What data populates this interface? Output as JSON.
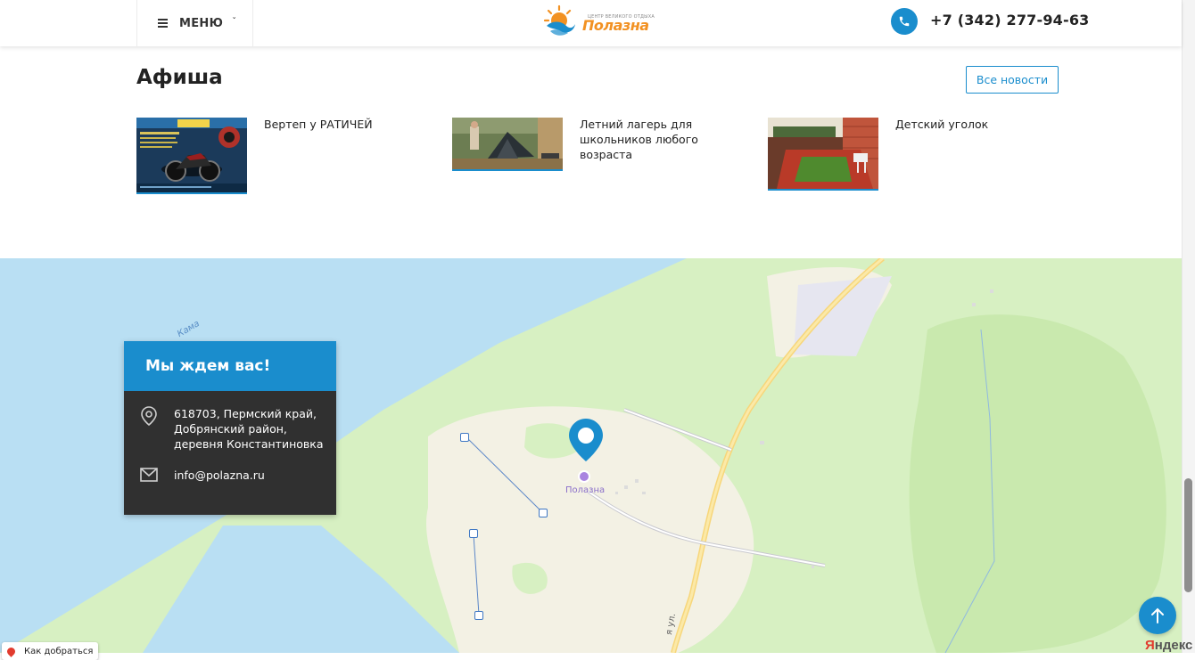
{
  "header": {
    "menu_label": "МЕНЮ",
    "menu_caret": "ˇ",
    "logo_small": "ЦЕНТР ВЕЛИКОГО ОТДЫХА",
    "logo_name": "Полазна",
    "phone": "+7 (342) 277-94-63"
  },
  "afisha": {
    "title": "Афиша",
    "all_news_label": "Все новости",
    "items": [
      {
        "title": "Вертеп у РАТИЧЕЙ",
        "image": "motorcycle-poster"
      },
      {
        "title": "Летний лагерь для школьников любого возраста",
        "image": "camp-tent-photo"
      },
      {
        "title": "Детский уголок",
        "image": "kids-corner-photo"
      }
    ]
  },
  "map": {
    "river_label": "Кама",
    "place_label": "Полазна",
    "street_label": "я ул.",
    "route_label": "Как добраться",
    "provider_prefix": "Я",
    "provider_rest": "ндекс"
  },
  "contact": {
    "title": "Мы ждем вас!",
    "address": "618703, Пермский край, Добрянский район, деревня Константиновка",
    "email": "info@polazna.ru"
  },
  "colors": {
    "accent": "#1a8dcd",
    "brand_orange": "#f29122",
    "card_dark": "#303030",
    "water": "#b9dff3",
    "forest": "#d7f0c2"
  }
}
